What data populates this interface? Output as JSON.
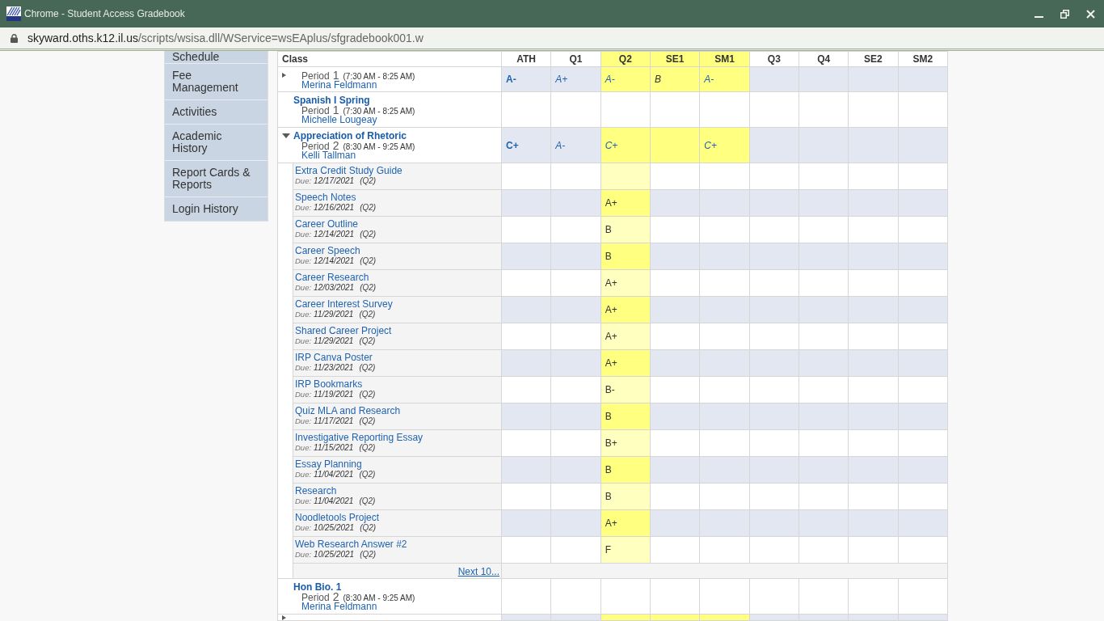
{
  "window": {
    "title": "Chrome - Student Access Gradebook"
  },
  "address_bar": {
    "host": "skyward.oths.k12.il.us",
    "path": "/scripts/wsisa.dll/WService=wsEAplus/sfgradebook001.w"
  },
  "sidebar": {
    "items": [
      {
        "label": "Schedule"
      },
      {
        "label": "Fee Management"
      },
      {
        "label": "Activities"
      },
      {
        "label": "Academic History"
      },
      {
        "label": "Report Cards & Reports"
      },
      {
        "label": "Login History"
      }
    ]
  },
  "gradebook": {
    "columns": [
      {
        "label": "Class",
        "highlighted": false
      },
      {
        "label": "ATH",
        "highlighted": false
      },
      {
        "label": "Q1",
        "highlighted": false
      },
      {
        "label": "Q2",
        "highlighted": true
      },
      {
        "label": "SE1",
        "highlighted": true
      },
      {
        "label": "SM1",
        "highlighted": true
      },
      {
        "label": "Q3",
        "highlighted": false
      },
      {
        "label": "Q4",
        "highlighted": false
      },
      {
        "label": "SE2",
        "highlighted": false
      },
      {
        "label": "SM2",
        "highlighted": false
      }
    ],
    "classes": [
      {
        "expanded": false,
        "shaded": true,
        "period_label": "Period",
        "period": "1",
        "time": "(7:30 AM - 8:25 AM)",
        "teacher": "Merina Feldmann",
        "grades": [
          {
            "grade": "A-",
            "bold": true,
            "italic": false,
            "link": true,
            "highlighted": false
          },
          {
            "grade": "A+",
            "bold": false,
            "italic": true,
            "link": true,
            "highlighted": false
          },
          {
            "grade": "A-",
            "bold": false,
            "italic": true,
            "link": true,
            "highlighted": true
          },
          {
            "grade": "B",
            "bold": false,
            "italic": true,
            "link": false,
            "highlighted": true
          },
          {
            "grade": "A-",
            "bold": false,
            "italic": true,
            "link": true,
            "highlighted": true
          }
        ]
      },
      {
        "name": "Spanish I Spring",
        "shaded": false,
        "period_label": "Period",
        "period": "1",
        "time": "(7:30 AM - 8:25 AM)",
        "teacher": "Michelle Lougeay"
      },
      {
        "name": "Appreciation of Rhetoric",
        "expanded": true,
        "shaded": true,
        "period_label": "Period",
        "period": "2",
        "time": "(8:30 AM - 9:25 AM)",
        "teacher": "Kelli Tallman",
        "grades": [
          {
            "grade": "C+",
            "bold": true,
            "italic": false,
            "link": true,
            "highlighted": false
          },
          {
            "grade": "A-",
            "bold": false,
            "italic": true,
            "link": true,
            "highlighted": false
          },
          {
            "grade": "C+",
            "bold": false,
            "italic": true,
            "link": true,
            "highlighted": true
          },
          {
            "highlighted": true
          },
          {
            "grade": "C+",
            "bold": false,
            "italic": true,
            "link": true,
            "highlighted": true
          }
        ],
        "assignments": [
          {
            "name": "Extra Credit Study Guide",
            "due_label": "Due:",
            "due": "12/17/2021",
            "term": "(Q2)",
            "shaded": false,
            "grades": [
              {
                "highlighted": false
              },
              {
                "highlighted": false
              },
              {
                "highlighted": true
              }
            ]
          },
          {
            "name": "Speech Notes",
            "due_label": "Due:",
            "due": "12/16/2021",
            "term": "(Q2)",
            "shaded": true,
            "grades": [
              {
                "highlighted": false
              },
              {
                "highlighted": false
              },
              {
                "highlighted": true,
                "grade": "A+"
              }
            ]
          },
          {
            "name": "Career Outline",
            "due_label": "Due:",
            "due": "12/14/2021",
            "term": "(Q2)",
            "shaded": false,
            "grades": [
              {
                "highlighted": false
              },
              {
                "highlighted": false
              },
              {
                "highlighted": true,
                "grade": "B"
              }
            ]
          },
          {
            "name": "Career Speech",
            "due_label": "Due:",
            "due": "12/14/2021",
            "term": "(Q2)",
            "shaded": true,
            "grades": [
              {
                "highlighted": false
              },
              {
                "highlighted": false
              },
              {
                "highlighted": true,
                "grade": "B"
              }
            ]
          },
          {
            "name": "Career Research",
            "due_label": "Due:",
            "due": "12/03/2021",
            "term": "(Q2)",
            "shaded": false,
            "grades": [
              {
                "highlighted": false
              },
              {
                "highlighted": false
              },
              {
                "highlighted": true,
                "grade": "A+"
              }
            ]
          },
          {
            "name": "Career Interest Survey",
            "due_label": "Due:",
            "due": "11/29/2021",
            "term": "(Q2)",
            "shaded": true,
            "grades": [
              {
                "highlighted": false
              },
              {
                "highlighted": false
              },
              {
                "highlighted": true,
                "grade": "A+"
              }
            ]
          },
          {
            "name": "Shared Career Project",
            "due_label": "Due:",
            "due": "11/29/2021",
            "term": "(Q2)",
            "shaded": false,
            "grades": [
              {
                "highlighted": false
              },
              {
                "highlighted": false
              },
              {
                "highlighted": true,
                "grade": "A+"
              }
            ]
          },
          {
            "name": "IRP Canva Poster",
            "due_label": "Due:",
            "due": "11/23/2021",
            "term": "(Q2)",
            "shaded": true,
            "grades": [
              {
                "highlighted": false
              },
              {
                "highlighted": false
              },
              {
                "highlighted": true,
                "grade": "A+"
              }
            ]
          },
          {
            "name": "IRP Bookmarks",
            "due_label": "Due:",
            "due": "11/19/2021",
            "term": "(Q2)",
            "shaded": false,
            "grades": [
              {
                "highlighted": false
              },
              {
                "highlighted": false
              },
              {
                "highlighted": true,
                "grade": "B-"
              }
            ]
          },
          {
            "name": "Quiz MLA and Research",
            "due_label": "Due:",
            "due": "11/17/2021",
            "term": "(Q2)",
            "shaded": true,
            "grades": [
              {
                "highlighted": false
              },
              {
                "highlighted": false
              },
              {
                "highlighted": true,
                "grade": "B"
              }
            ]
          },
          {
            "name": "Investigative Reporting Essay",
            "due_label": "Due:",
            "due": "11/15/2021",
            "term": "(Q2)",
            "shaded": false,
            "grades": [
              {
                "highlighted": false
              },
              {
                "highlighted": false
              },
              {
                "highlighted": true,
                "grade": "B+"
              }
            ]
          },
          {
            "name": "Essay Planning",
            "due_label": "Due:",
            "due": "11/04/2021",
            "term": "(Q2)",
            "shaded": true,
            "grades": [
              {
                "highlighted": false
              },
              {
                "highlighted": false
              },
              {
                "highlighted": true,
                "grade": "B"
              }
            ]
          },
          {
            "name": "Research",
            "due_label": "Due:",
            "due": "11/04/2021",
            "term": "(Q2)",
            "shaded": false,
            "grades": [
              {
                "highlighted": false
              },
              {
                "highlighted": false
              },
              {
                "highlighted": true,
                "grade": "B"
              }
            ]
          },
          {
            "name": "Noodletools Project",
            "due_label": "Due:",
            "due": "10/25/2021",
            "term": "(Q2)",
            "shaded": true,
            "grades": [
              {
                "highlighted": false
              },
              {
                "highlighted": false
              },
              {
                "highlighted": true,
                "grade": "A+"
              }
            ]
          },
          {
            "name": "Web Research Answer #2",
            "due_label": "Due:",
            "due": "10/25/2021",
            "term": "(Q2)",
            "shaded": false,
            "grades": [
              {
                "highlighted": false
              },
              {
                "highlighted": false
              },
              {
                "highlighted": true,
                "grade": "F"
              }
            ]
          }
        ],
        "more_link": "Next 10..."
      },
      {
        "name": "Hon Bio. 1",
        "shaded": false,
        "period_label": "Period",
        "period": "2",
        "time": "(8:30 AM - 9:25 AM)",
        "teacher": "Merina Feldmann"
      },
      {
        "expanded": false,
        "shaded": true,
        "grades": [
          {
            "highlighted": false
          },
          {
            "highlighted": false
          },
          {
            "highlighted": true
          },
          {
            "highlighted": true
          },
          {
            "highlighted": true
          }
        ]
      }
    ]
  }
}
